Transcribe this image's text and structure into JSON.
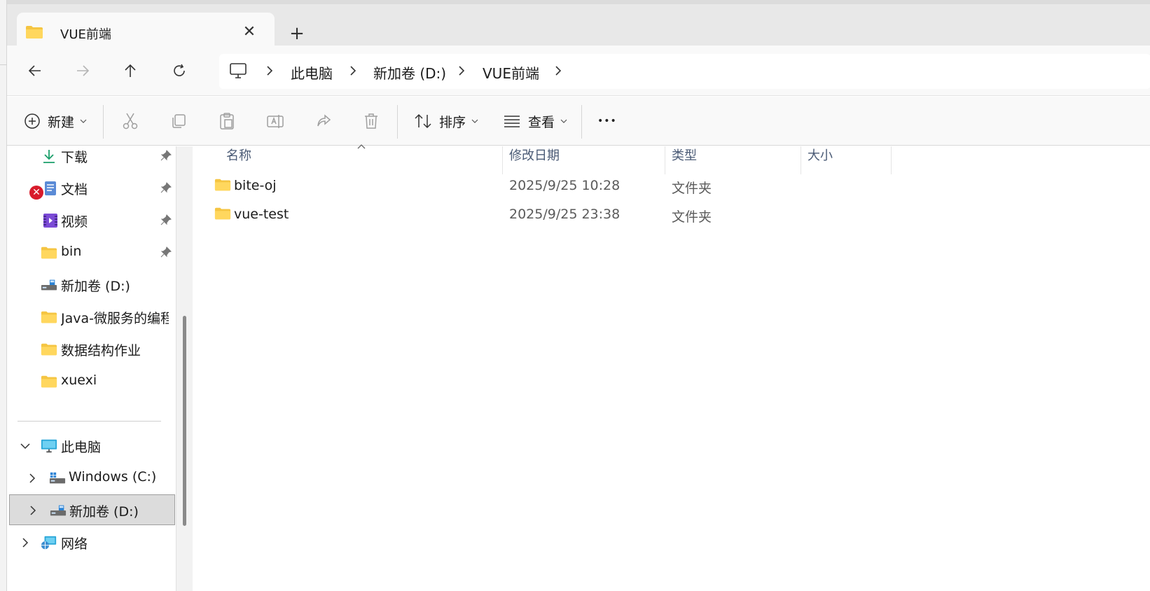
{
  "tab": {
    "title": "VUE前端",
    "close_glyph": "✕",
    "new_glyph": "+"
  },
  "breadcrumb": [
    "此电脑",
    "新加卷 (D:)",
    "VUE前端"
  ],
  "commands": {
    "new_label": "新建",
    "sort_label": "排序",
    "view_label": "查看",
    "more_glyph": "•••"
  },
  "sidebar": {
    "quick_access": [
      {
        "label": "下载",
        "icon": "download-icon",
        "pinned": true
      },
      {
        "label": "文档",
        "icon": "document-icon",
        "pinned": true,
        "error_badge": "✕"
      },
      {
        "label": "视频",
        "icon": "video-icon",
        "pinned": true
      },
      {
        "label": "bin",
        "icon": "folder-icon",
        "pinned": true
      },
      {
        "label": "新加卷 (D:)",
        "icon": "drive-icon",
        "pinned": false
      },
      {
        "label": "Java-微服务的编程测",
        "icon": "folder-icon",
        "pinned": false
      },
      {
        "label": "数据结构作业",
        "icon": "folder-icon",
        "pinned": false
      },
      {
        "label": "xuexi",
        "icon": "folder-icon",
        "pinned": false
      }
    ],
    "tree": [
      {
        "label": "此电脑",
        "icon": "computer-icon",
        "expanded": true
      },
      {
        "label": "Windows (C:)",
        "icon": "windows-drive-icon",
        "expanded": false
      },
      {
        "label": "新加卷 (D:)",
        "icon": "drive-icon",
        "expanded": false,
        "selected": true
      },
      {
        "label": "网络",
        "icon": "network-icon",
        "expanded": false
      }
    ]
  },
  "columns": [
    "名称",
    "修改日期",
    "类型",
    "大小"
  ],
  "files": [
    {
      "name": "bite-oj",
      "modified": "2025/9/25 10:28",
      "type": "文件夹",
      "size": ""
    },
    {
      "name": "vue-test",
      "modified": "2025/9/25 23:38",
      "type": "文件夹",
      "size": ""
    }
  ],
  "colors": {
    "accent": "#0067c0",
    "folder": "#f5c542",
    "selected_bg": "#dcdcdc"
  }
}
